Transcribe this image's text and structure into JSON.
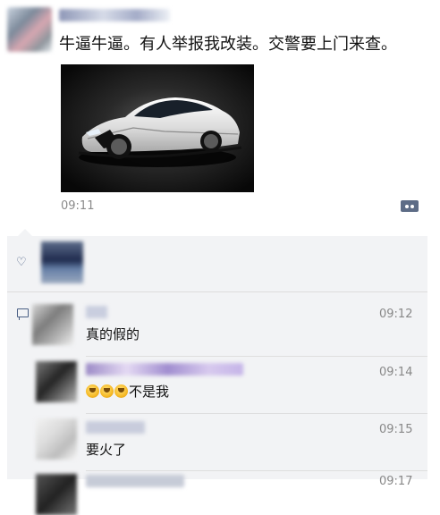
{
  "post": {
    "text": "牛逼牛逼。有人举报我改装。交警要上门来查。",
    "time": "09:11"
  },
  "comments": [
    {
      "text": "真的假的",
      "time": "09:12"
    },
    {
      "emoji_count": 3,
      "text": "不是我",
      "time": "09:14"
    },
    {
      "text": "要火了",
      "time": "09:15"
    },
    {
      "text": "",
      "time": "09:17"
    }
  ],
  "icons": {
    "like": "heart-icon",
    "comment": "comment-icon",
    "more": "more-dots-icon",
    "emoji": "laughing-face-emoji"
  }
}
